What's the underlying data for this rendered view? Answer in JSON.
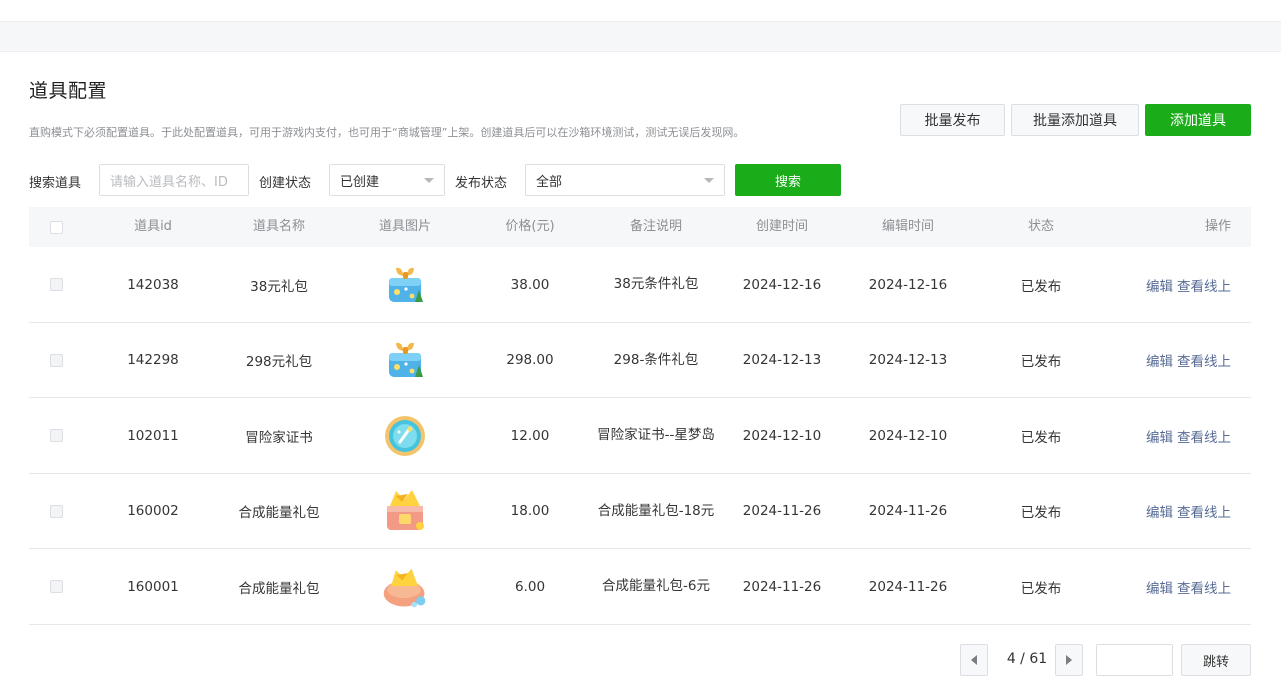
{
  "header": {
    "title": "道具配置",
    "description": "直购模式下必须配置道具。于此处配置道具，可用于游戏内支付，也可用于“商城管理”上架。创建道具后可以在沙箱环境测试，测试无误后发现网。"
  },
  "actions": {
    "batch_publish": "批量发布",
    "batch_add": "批量添加道具",
    "add": "添加道具"
  },
  "filters": {
    "search_label": "搜索道具",
    "search_placeholder": "请输入道具名称、ID",
    "create_status_label": "创建状态",
    "create_status_value": "已创建",
    "publish_status_label": "发布状态",
    "publish_status_value": "全部",
    "search_button": "搜索"
  },
  "table": {
    "columns": {
      "id": "道具id",
      "name": "道具名称",
      "image": "道具图片",
      "price": "价格(元)",
      "note": "备注说明",
      "created": "创建时间",
      "edited": "编辑时间",
      "status": "状态",
      "ops": "操作"
    },
    "rows": [
      {
        "id": "142038",
        "name": "38元礼包",
        "icon": "gift-box-icon",
        "price": "38.00",
        "note": "38元条件礼包",
        "created": "2024-12-16",
        "edited": "2024-12-16",
        "status": "已发布",
        "edit": "编辑",
        "view": "查看线上"
      },
      {
        "id": "142298",
        "name": "298元礼包",
        "icon": "gift-box-icon",
        "price": "298.00",
        "note": "298-条件礼包",
        "created": "2024-12-13",
        "edited": "2024-12-13",
        "status": "已发布",
        "edit": "编辑",
        "view": "查看线上"
      },
      {
        "id": "102011",
        "name": "冒险家证书",
        "icon": "badge-icon",
        "price": "12.00",
        "note": "冒险家证书--星梦岛",
        "created": "2024-12-10",
        "edited": "2024-12-10",
        "status": "已发布",
        "edit": "编辑",
        "view": "查看线上"
      },
      {
        "id": "160002",
        "name": "合成能量礼包",
        "icon": "energy-chest-icon",
        "price": "18.00",
        "note": "合成能量礼包-18元",
        "created": "2024-11-26",
        "edited": "2024-11-26",
        "status": "已发布",
        "edit": "编辑",
        "view": "查看线上"
      },
      {
        "id": "160001",
        "name": "合成能量礼包",
        "icon": "energy-bag-icon",
        "price": "6.00",
        "note": "合成能量礼包-6元",
        "created": "2024-11-26",
        "edited": "2024-11-26",
        "status": "已发布",
        "edit": "编辑",
        "view": "查看线上"
      }
    ]
  },
  "pagination": {
    "page_text": "4 / 61",
    "jump_label": "跳转"
  },
  "colors": {
    "primary": "#1aad19",
    "link": "#576b95"
  }
}
